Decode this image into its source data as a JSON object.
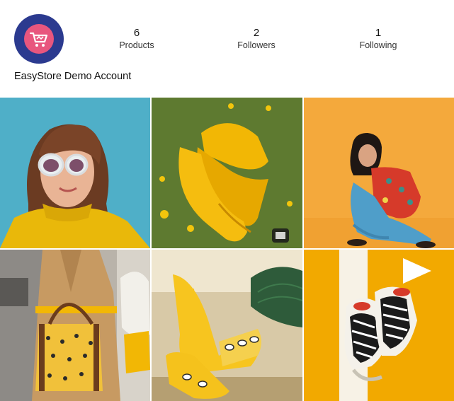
{
  "profile": {
    "avatar_icon": "shopping-cart-icon",
    "name": "EasyStore Demo Account"
  },
  "stats": [
    {
      "value": "6",
      "label": "Products"
    },
    {
      "value": "2",
      "label": "Followers"
    },
    {
      "value": "1",
      "label": "Following"
    }
  ],
  "posts": [
    {
      "subject": "woman-sunglasses-yellow-sweater-photo"
    },
    {
      "subject": "yellow-sneakers-on-grass-photo"
    },
    {
      "subject": "girl-crouching-orange-wall-photo"
    },
    {
      "subject": "trench-coat-yellow-bag-photo"
    },
    {
      "subject": "yellow-heels-bee-print-photo"
    },
    {
      "subject": "sneakers-yellow-background-photo"
    }
  ],
  "colors": {
    "avatar_bg": "#2b3a8f",
    "avatar_badge": "#e8567e",
    "accent_yellow": "#f2b705"
  }
}
